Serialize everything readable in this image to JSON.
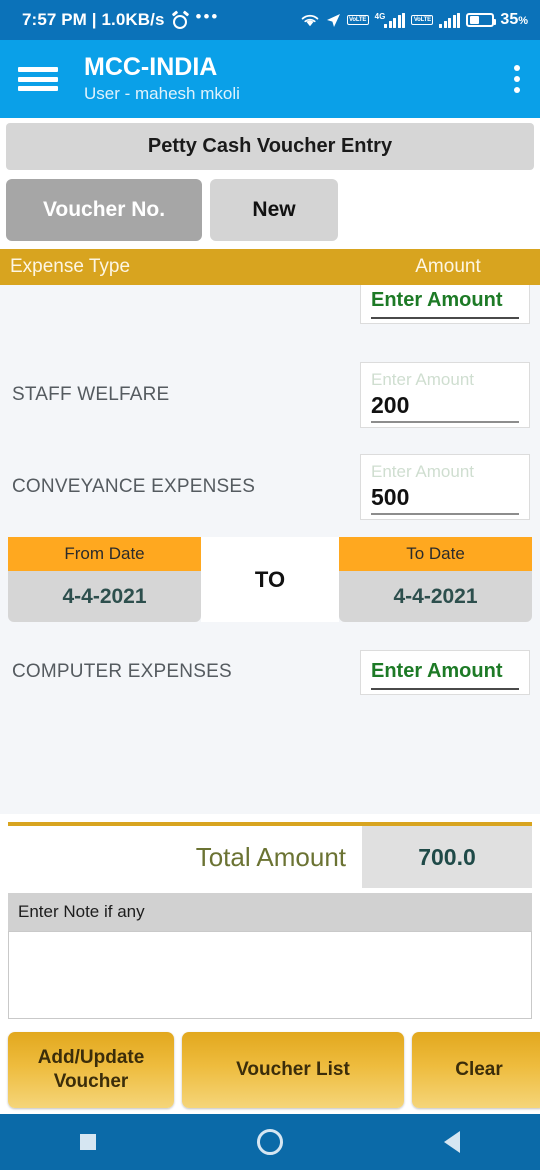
{
  "statusbar": {
    "time": "7:57 PM | 1.0KB/s",
    "alarm_icon": "alarm-icon",
    "more_dots": "•••",
    "wifi_icon": "wifi-icon",
    "location_icon": "location-arrow-icon",
    "volte1": "VoLTE",
    "network_label": "4G",
    "volte2": "VoLTE",
    "battery_pct": "35",
    "battery_pct_symbol": "%"
  },
  "appbar": {
    "menu_icon": "hamburger-menu-icon",
    "title": "MCC-INDIA",
    "subtitle": "User - mahesh mkoli",
    "overflow_icon": "kebab-menu-icon"
  },
  "page": {
    "title": "Petty Cash Voucher Entry"
  },
  "voucher": {
    "voucher_no_label": "Voucher No.",
    "new_label": "New"
  },
  "table": {
    "col_expense_type": "Expense Type",
    "col_amount": "Amount",
    "amount_placeholder": "Enter Amount"
  },
  "rows": [
    {
      "label": "",
      "value": "",
      "hint": "Enter Amount",
      "filled": false,
      "partial": true
    },
    {
      "label": "STAFF WELFARE",
      "value": "200",
      "hint": "Enter Amount",
      "filled": true,
      "partial": false
    },
    {
      "label": "CONVEYANCE EXPENSES",
      "value": "500",
      "hint": "Enter Amount",
      "filled": true,
      "partial": false
    },
    {
      "label": "COMPUTER EXPENSES",
      "value": "",
      "hint": "Enter Amount",
      "filled": false,
      "partial": false
    }
  ],
  "daterange": {
    "from_label": "From Date",
    "from_value": "4-4-2021",
    "separator": "TO",
    "to_label": "To Date",
    "to_value": "4-4-2021"
  },
  "total": {
    "label": "Total Amount",
    "value": "700.0"
  },
  "note": {
    "header": "Enter Note if any",
    "value": "",
    "placeholder": ""
  },
  "actions": {
    "add_update": "Add/Update Voucher",
    "add_update_line1": "Add/Update",
    "add_update_line2": "Voucher",
    "voucher_list": "Voucher List",
    "clear": "Clear"
  },
  "navbar": {
    "recent_icon": "recent-apps-icon",
    "home_icon": "home-icon",
    "back_icon": "back-icon"
  },
  "colors": {
    "status_bar": "#0b72b9",
    "app_bar": "#0aa0e8",
    "table_header": "#d8a41f",
    "date_header": "#ffa81f",
    "gold_button": "#eebc3e",
    "total_label": "#6b7333",
    "hint_green": "#1d7a26",
    "nav_bar": "#0b6aa8"
  }
}
